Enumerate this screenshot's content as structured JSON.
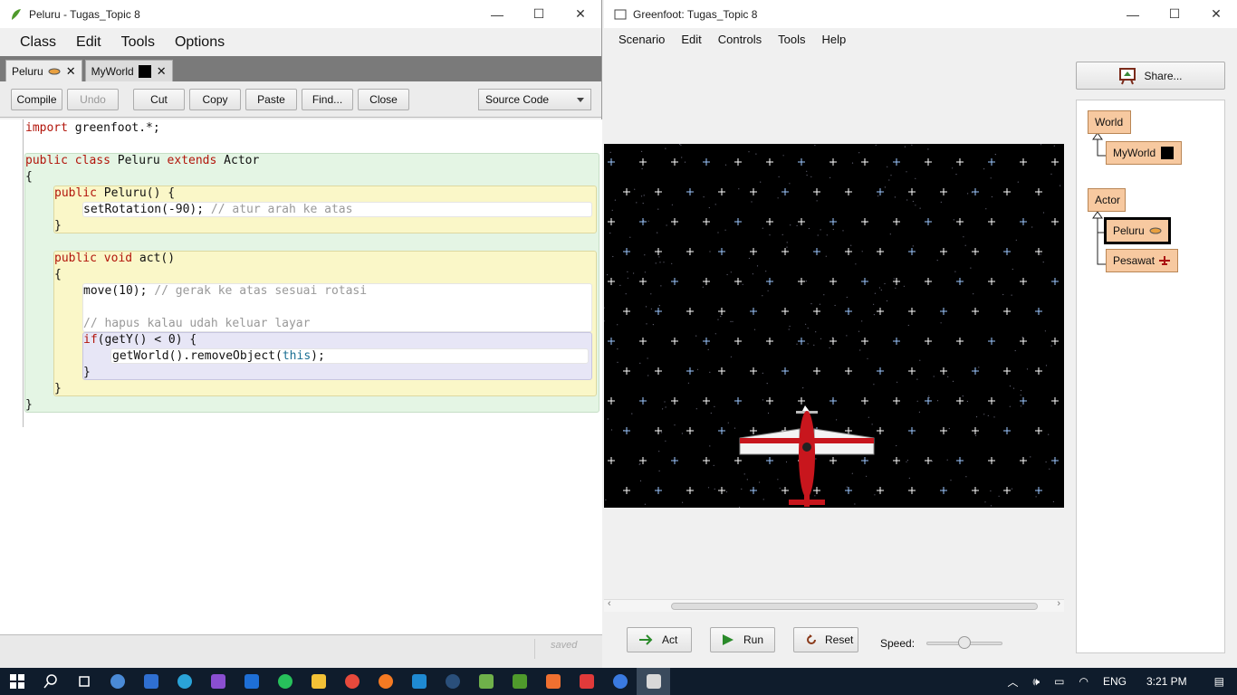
{
  "editor": {
    "title": "Peluru - Tugas_Topic 8",
    "menu": [
      "Class",
      "Edit",
      "Tools",
      "Options"
    ],
    "tabs": [
      {
        "label": "Peluru"
      },
      {
        "label": "MyWorld"
      }
    ],
    "toolbar": {
      "compile": "Compile",
      "undo": "Undo",
      "cut": "Cut",
      "copy": "Copy",
      "paste": "Paste",
      "find": "Find...",
      "close": "Close",
      "view_mode": "Source Code"
    },
    "code": {
      "l1_kw": "import",
      "l1_rest": " greenfoot.*;",
      "l2_a": "public class ",
      "l2_b": "Peluru ",
      "l2_c": "extends ",
      "l2_d": "Actor",
      "l3": "{",
      "l4_kw": "public ",
      "l4_rest": "Peluru() {",
      "l5_code": "setRotation(-90); ",
      "l5_comment": "// atur arah ke atas",
      "l6": "}",
      "l7_kw": "public void ",
      "l7_rest": "act()",
      "l8": "{",
      "l9_code": "move(10); ",
      "l9_comment": "// gerak ke atas sesuai rotasi",
      "l10_comment": "// hapus kalau udah keluar layar",
      "l11_kw": "if",
      "l11_rest": "(getY() < 0) {",
      "l12_a": "getWorld().removeObject(",
      "l12_b": "this",
      "l12_c": ");",
      "l13": "}",
      "l14": "}",
      "l15": "}"
    },
    "status": "saved"
  },
  "greenfoot": {
    "title": "Greenfoot: Tugas_Topic 8",
    "menu": [
      "Scenario",
      "Edit",
      "Controls",
      "Tools",
      "Help"
    ],
    "share": "Share...",
    "classes": {
      "world": "World",
      "myworld": "MyWorld",
      "actor": "Actor",
      "peluru": "Peluru",
      "pesawat": "Pesawat"
    },
    "controls": {
      "act": "Act",
      "run": "Run",
      "reset": "Reset",
      "speed_label": "Speed:",
      "speed_value": 0.5
    }
  },
  "taskbar": {
    "language": "ENG",
    "time": "3:21 PM"
  },
  "colors": {
    "class_box": "#f7c9a0",
    "taskbar": "#0f1c2c",
    "keyword": "#b2150b"
  }
}
